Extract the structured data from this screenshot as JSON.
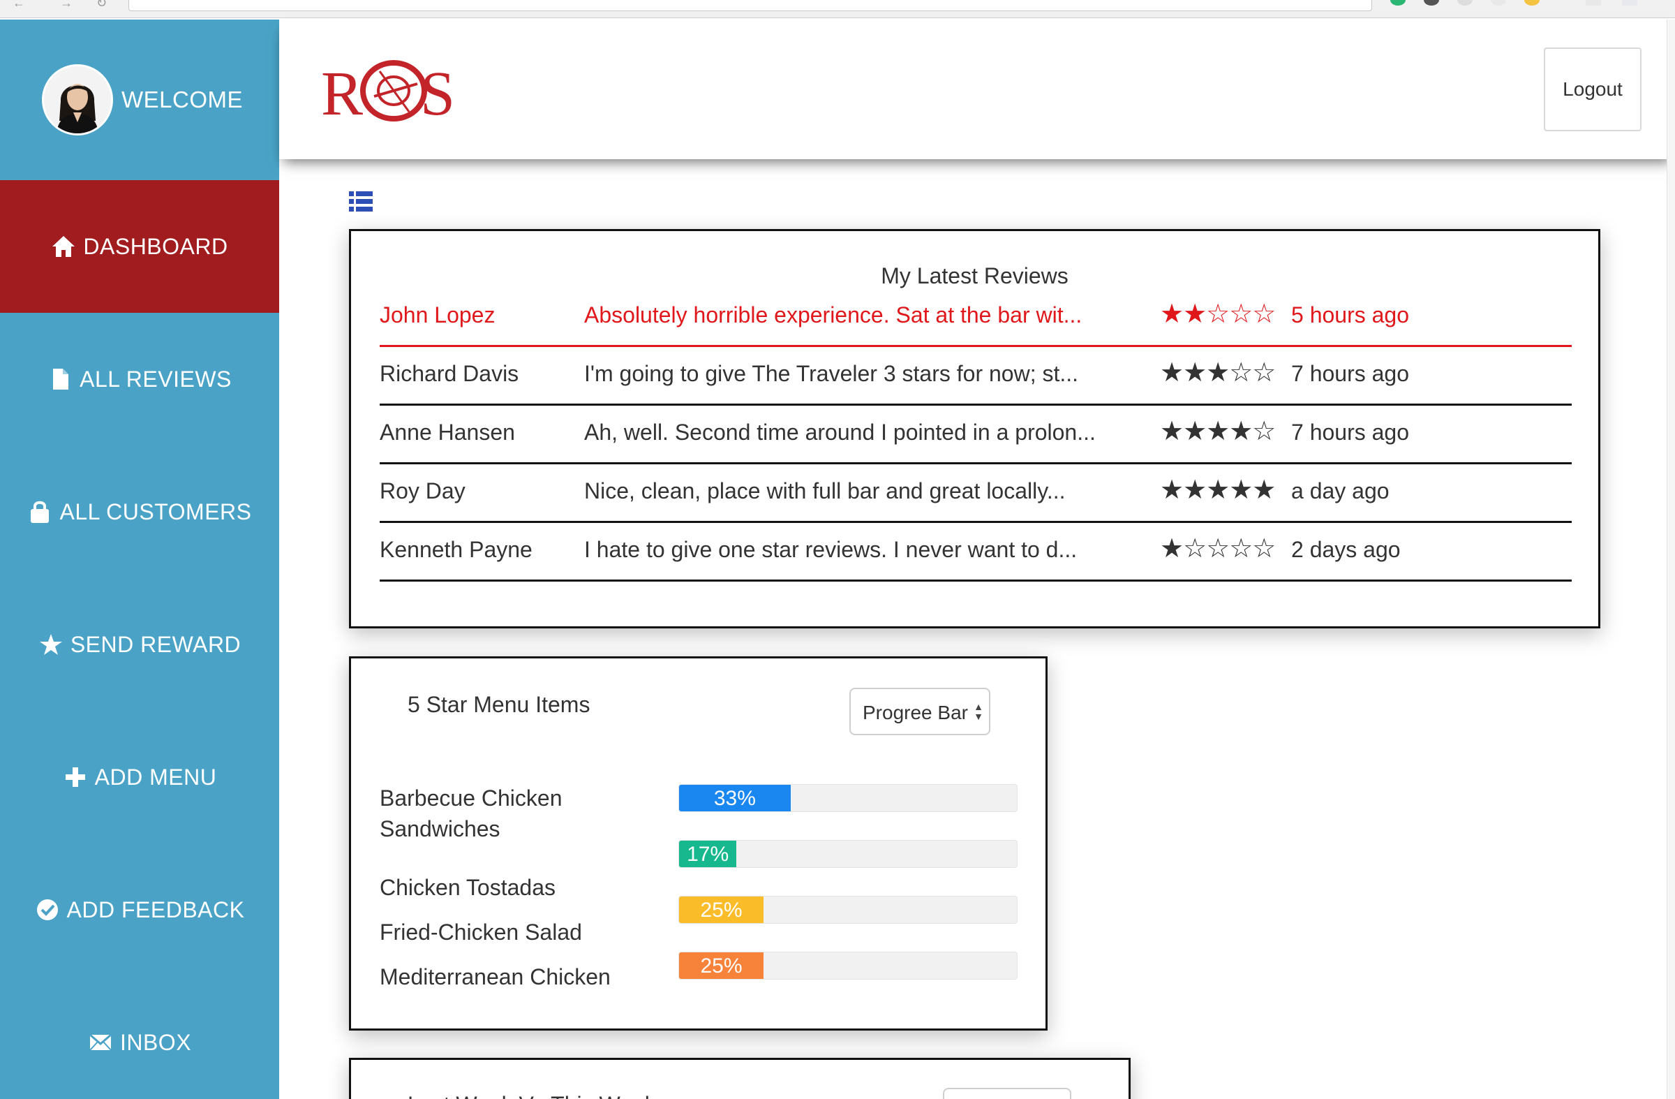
{
  "sidebar": {
    "welcome_label": "WELCOME",
    "items": [
      {
        "label": "DASHBOARD",
        "icon": "home-icon",
        "active": true
      },
      {
        "label": "ALL REVIEWS",
        "icon": "document-icon",
        "active": false
      },
      {
        "label": "ALL CUSTOMERS",
        "icon": "lock-icon",
        "active": false
      },
      {
        "label": "SEND REWARD",
        "icon": "star-icon",
        "active": false
      },
      {
        "label": "ADD MENU",
        "icon": "plus-icon",
        "active": false
      },
      {
        "label": "ADD FEEDBACK",
        "icon": "check-circle-icon",
        "active": false
      },
      {
        "label": "INBOX",
        "icon": "envelope-icon",
        "active": false
      }
    ]
  },
  "header": {
    "logo_text": "ROS",
    "logout_label": "Logout"
  },
  "latest_reviews": {
    "title": "My Latest Reviews",
    "rows": [
      {
        "name": "John Lopez",
        "text": "Absolutely horrible experience. Sat at the bar wit...",
        "stars": "★★☆☆☆",
        "rating": 2,
        "time": "5 hours ago",
        "highlight": true
      },
      {
        "name": "Richard Davis",
        "text": "I'm going to give The Traveler 3 stars for now; st...",
        "stars": "★★★☆☆",
        "rating": 3,
        "time": "7 hours ago",
        "highlight": false
      },
      {
        "name": "Anne Hansen",
        "text": "Ah, well. Second time around I pointed in a prolon...",
        "stars": "★★★★☆",
        "rating": 4,
        "time": "7 hours ago",
        "highlight": false
      },
      {
        "name": "Roy Day",
        "text": "Nice, clean, place with full bar and great locally...",
        "stars": "★★★★★",
        "rating": 5,
        "time": "a day ago",
        "highlight": false
      },
      {
        "name": "Kenneth Payne",
        "text": "I hate to give one star reviews. I never want to d...",
        "stars": "★☆☆☆☆",
        "rating": 1,
        "time": "2 days ago",
        "highlight": false
      }
    ]
  },
  "menu_items": {
    "title": "5 Star Menu Items",
    "view_select": "Progree Bar",
    "items": [
      {
        "label": "Barbecue Chicken Sandwiches",
        "percent": 33,
        "percent_label": "33%",
        "color": "#1a86f0"
      },
      {
        "label": "Chicken Tostadas",
        "percent": 17,
        "percent_label": "17%",
        "color": "#17b88d"
      },
      {
        "label": "Fried-Chicken Salad",
        "percent": 25,
        "percent_label": "25%",
        "color": "#fbbc2a"
      },
      {
        "label": "Mediterranean Chicken",
        "percent": 25,
        "percent_label": "25%",
        "color": "#f7823a"
      }
    ]
  },
  "week_compare": {
    "title": "Last Week Vs This Week"
  },
  "colors": {
    "sidebar": "#4aa3c6",
    "active_nav": "#a01c1f",
    "highlight_review": "#e0181b"
  }
}
